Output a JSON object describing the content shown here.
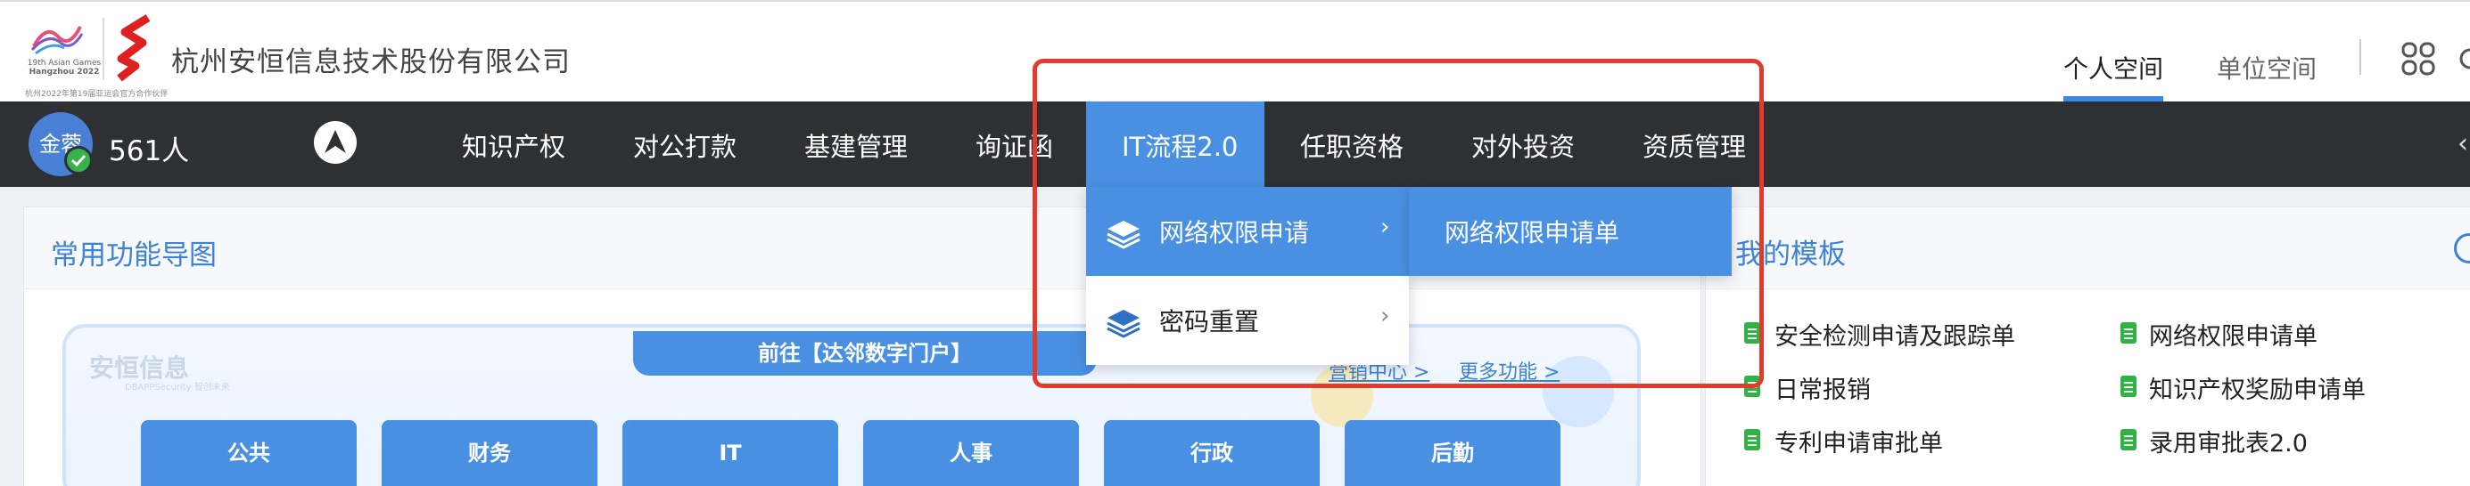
{
  "header": {
    "company_name": "杭州安恒信息技术股份有限公司",
    "asian_games_caption_1": "19th Asian Games",
    "asian_games_caption_2": "Hangzhou 2022",
    "logo_tiny_text": "杭州2022年第19届亚运会官方合作伙伴",
    "space_tabs": [
      {
        "label": "个人空间",
        "active": true
      },
      {
        "label": "单位空间",
        "active": false
      }
    ]
  },
  "navbar": {
    "user_name": "金蓉",
    "user_count": "561人",
    "items": [
      {
        "label": "知识产权"
      },
      {
        "label": "对公打款"
      },
      {
        "label": "基建管理"
      },
      {
        "label": "询证函"
      },
      {
        "label": "IT流程2.0",
        "active": true
      },
      {
        "label": "任职资格"
      },
      {
        "label": "对外投资"
      },
      {
        "label": "资质管理"
      }
    ],
    "edge_glyph": "‹"
  },
  "dropdown": {
    "items": [
      {
        "label": "网络权限申请",
        "icon": "layers-icon",
        "highlighted": true
      },
      {
        "label": "密码重置",
        "icon": "layers-icon",
        "highlighted": false
      }
    ],
    "chevron": "›",
    "submenu": {
      "label": "网络权限申请单"
    }
  },
  "left_panel": {
    "title": "常用功能导图",
    "portal_banner": "前往【达邻数字门户】",
    "watermark": "安恒信息",
    "watermark_sub": "DBAPPSecurity 智创未来",
    "links": [
      "营销中心 >",
      "更多功能 >"
    ],
    "categories": [
      "公共",
      "财务",
      "IT",
      "人事",
      "行政",
      "后勤"
    ]
  },
  "right_panel": {
    "title": "我的模板",
    "templates": [
      {
        "label": "安全检测申请及跟踪单"
      },
      {
        "label": "网络权限申请单"
      },
      {
        "label": "日常报销"
      },
      {
        "label": "知识产权奖励申请单"
      },
      {
        "label": "专利申请审批单"
      },
      {
        "label": "录用审批表2.0"
      }
    ]
  },
  "colors": {
    "nav_bg": "#2e3033",
    "accent": "#4a90e2",
    "title_blue": "#3d82d6",
    "annotation_red": "#e23b2e",
    "doc_green": "#2fb344"
  }
}
